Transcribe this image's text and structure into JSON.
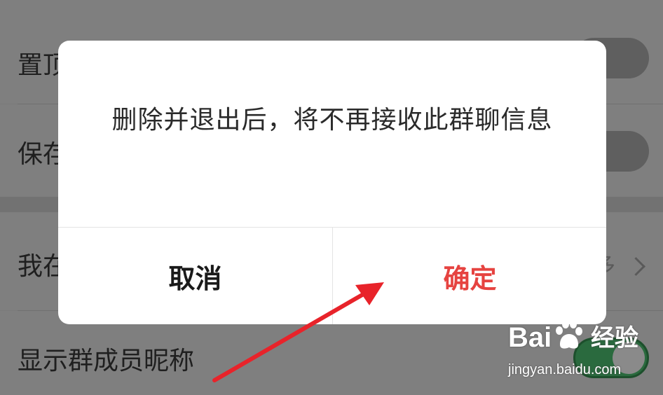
{
  "settings": {
    "rows": [
      {
        "label": "置顶聊天",
        "toggle": "off"
      },
      {
        "label": "保存到通讯录",
        "toggle": "off"
      },
      {
        "label": "我在本群的昵称",
        "value": "多"
      },
      {
        "label": "显示群成员昵称",
        "toggle": "on"
      }
    ]
  },
  "dialog": {
    "message": "删除并退出后，将不再接收此群聊信息",
    "cancel_label": "取消",
    "confirm_label": "确定"
  },
  "colors": {
    "confirm": "#e64340",
    "arrow": "#e8232a"
  },
  "watermark": {
    "brand_left": "Bai",
    "brand_right": "经验",
    "url": "jingyan.baidu.com"
  },
  "icons": {
    "chevron": "chevron-right-icon",
    "arrow": "annotation-arrow-icon",
    "paw": "baidu-paw-icon"
  }
}
